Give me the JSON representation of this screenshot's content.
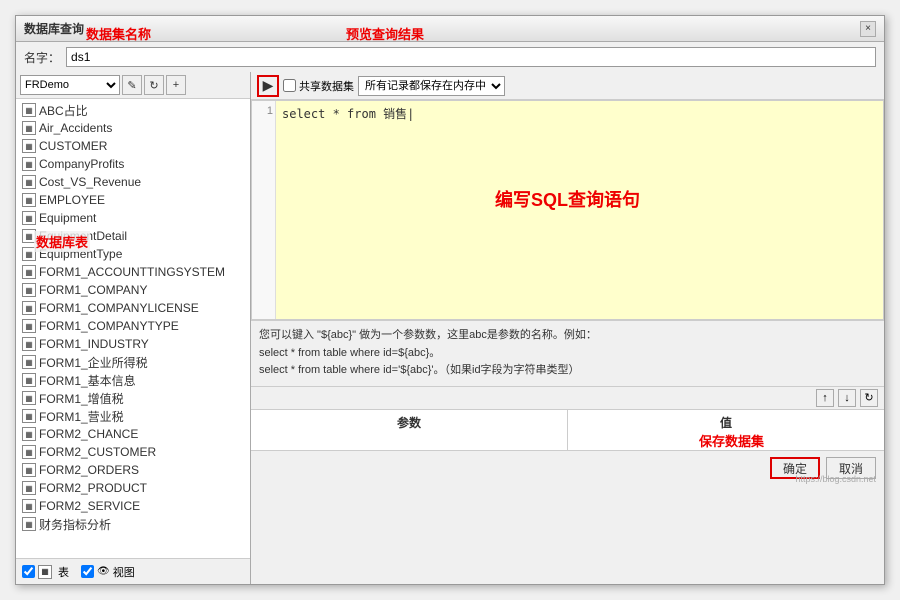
{
  "dialog": {
    "title": "数据库查询",
    "close_label": "×"
  },
  "name_row": {
    "label": "名字：",
    "value": "ds1",
    "annotation_dataset": "数据集名称",
    "annotation_preview": "预览查询结果"
  },
  "left_panel": {
    "db_select": "FRDemo",
    "annotation_db": "数据库表",
    "tree_items": [
      "ABC占比",
      "Air_Accidents",
      "CUSTOMER",
      "CompanyProfits",
      "Cost_VS_Revenue",
      "EMPLOYEE",
      "Equipment",
      "EquipmentDetail",
      "EquipmentType",
      "FORM1_ACCOUNTTINGSYSTEM",
      "FORM1_COMPANY",
      "FORM1_COMPANYLICENSE",
      "FORM1_COMPANYTYPE",
      "FORM1_INDUSTRY",
      "FORM1_企业所得税",
      "FORM1_基本信息",
      "FORM1_增值税",
      "FORM1_营业税",
      "FORM2_CHANCE",
      "FORM2_CUSTOMER",
      "FORM2_ORDERS",
      "FORM2_PRODUCT",
      "FORM2_SERVICE",
      "财务指标分析"
    ],
    "checkbox_table": "表",
    "checkbox_view": "视图"
  },
  "right_panel": {
    "preview_icon": "▶",
    "share_label": "共享数据集",
    "cache_label": "所有记录都保存在内存中",
    "sql_line": "1",
    "sql_text": "select * from 销售|",
    "sql_center_label": "编写SQL查询语句",
    "hint_line1": "您可以键入 \"${abc}\" 做为一个参数数，这里abc是参数的名称。例如：",
    "hint_line2": "select * from table where id=${abc}。",
    "hint_line3": "select * from table where id='${abc}'。（如果id字段为字符串类型）",
    "params_col1": "参数",
    "params_col2": "值",
    "annotation_save": "保存数据集"
  },
  "buttons": {
    "ok": "确定",
    "cancel": "取消"
  },
  "watermark": "https://blog.csdn.net"
}
